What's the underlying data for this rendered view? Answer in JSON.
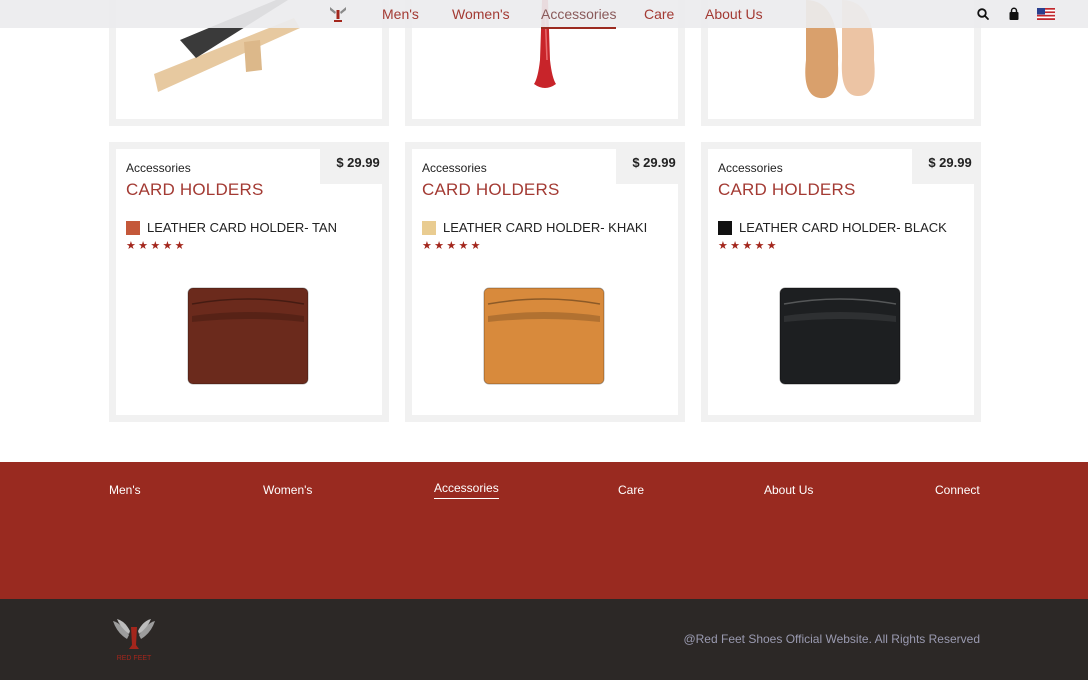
{
  "nav": {
    "items": [
      {
        "label": "Men's"
      },
      {
        "label": "Women's"
      },
      {
        "label": "Accessories",
        "active": true
      },
      {
        "label": "Care"
      },
      {
        "label": "About Us"
      }
    ],
    "utility_icons": [
      "search-icon",
      "shopping-bag-icon",
      "us-flag-icon"
    ]
  },
  "products": [
    {
      "category": "Accessories",
      "title": "CARD HOLDERS",
      "price": "$ 29.99",
      "name": "LEATHER CARD HOLDER- TAN",
      "swatch_color": "#c4583a",
      "stars": "★★★★★",
      "rating": 5,
      "wallet_color": "#6b2a1c"
    },
    {
      "category": "Accessories",
      "title": "CARD HOLDERS",
      "price": "$ 29.99",
      "name": "LEATHER CARD HOLDER- KHAKI",
      "swatch_color": "#e9cc91",
      "stars": "★★★★★",
      "rating": 5,
      "wallet_color": "#d88a3c"
    },
    {
      "category": "Accessories",
      "title": "CARD HOLDERS",
      "price": "$ 29.99",
      "name": "LEATHER CARD HOLDER- BLACK",
      "swatch_color": "#111111",
      "stars": "★★★★★",
      "rating": 5,
      "wallet_color": "#1d1f21"
    }
  ],
  "footer": {
    "links": [
      {
        "label": "Men's"
      },
      {
        "label": "Women's"
      },
      {
        "label": "Accessories",
        "active": true
      },
      {
        "label": "Care"
      },
      {
        "label": "About Us"
      },
      {
        "label": "Connect"
      }
    ],
    "copyright": "@Red Feet Shoes Official Website. All Rights Reserved",
    "logo_text": "RED FEET"
  },
  "colors": {
    "brand_red": "#992a20",
    "nav_text": "#a33a33",
    "footer_dark": "#2c2826",
    "star": "#a3261c"
  }
}
